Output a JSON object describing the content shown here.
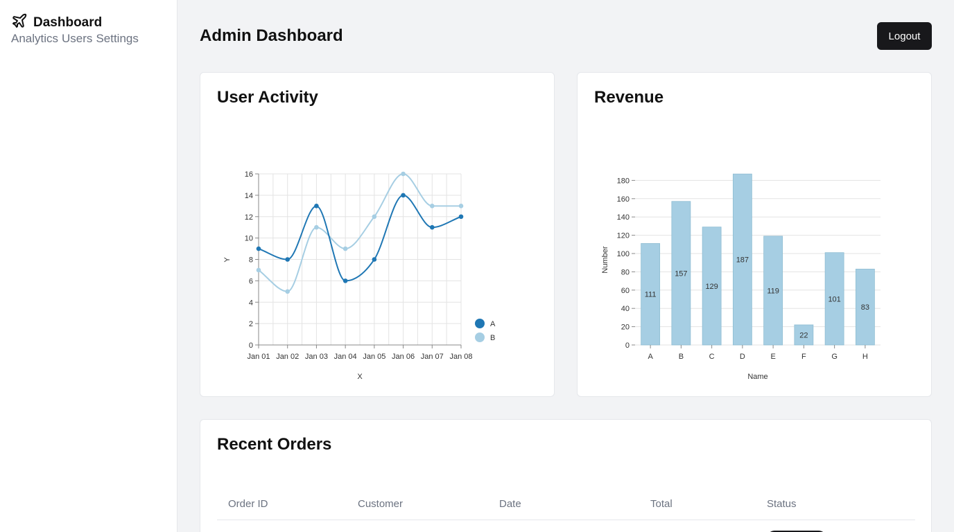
{
  "sidebar": {
    "brand": "Dashboard",
    "brand_icon": "plane-icon",
    "nav": [
      "Analytics",
      "Users",
      "Settings"
    ]
  },
  "header": {
    "title": "Admin Dashboard",
    "logout_label": "Logout"
  },
  "activity": {
    "title": "User Activity",
    "chart_data": {
      "type": "line",
      "x": [
        "Jan 01",
        "Jan 02",
        "Jan 03",
        "Jan 04",
        "Jan 05",
        "Jan 06",
        "Jan 07",
        "Jan 08"
      ],
      "series": [
        {
          "name": "A",
          "values": [
            9,
            8,
            13,
            6,
            8,
            14,
            11,
            12
          ],
          "color": "#1f77b4"
        },
        {
          "name": "B",
          "values": [
            7,
            5,
            11,
            9,
            12,
            16,
            13,
            13
          ],
          "color": "#a6cee3"
        }
      ],
      "xlabel": "X",
      "ylabel": "Y",
      "ylim": [
        0,
        16
      ],
      "yticks": [
        0,
        2,
        4,
        6,
        8,
        10,
        12,
        14,
        16
      ],
      "grid": true,
      "legend": "right"
    }
  },
  "revenue": {
    "title": "Revenue",
    "chart_data": {
      "type": "bar",
      "categories": [
        "A",
        "B",
        "C",
        "D",
        "E",
        "F",
        "G",
        "H"
      ],
      "values": [
        111,
        157,
        129,
        187,
        119,
        22,
        101,
        83
      ],
      "xlabel": "Name",
      "ylabel": "Number",
      "ylim": [
        0,
        180
      ],
      "yticks": [
        0,
        20,
        40,
        60,
        80,
        100,
        120,
        140,
        160,
        180
      ],
      "color": "#a6cee3",
      "grid": true
    }
  },
  "orders": {
    "title": "Recent Orders",
    "columns": [
      "Order ID",
      "Customer",
      "Date",
      "Total",
      "Status"
    ]
  }
}
